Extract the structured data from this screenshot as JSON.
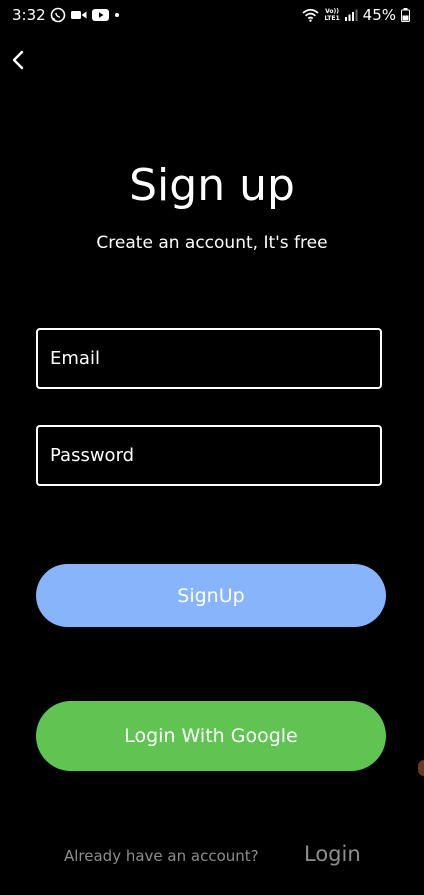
{
  "status_bar": {
    "time": "3:32",
    "lte_top": "Vo))",
    "lte_bottom": "LTE1",
    "battery": "45%"
  },
  "header": {
    "back_icon": "chevron-left-icon"
  },
  "main": {
    "title": "Sign up",
    "subtitle": "Create an account, It's free",
    "email_placeholder": "Email",
    "password_placeholder": "Password",
    "signup_label": "SignUp",
    "google_label": "Login With Google"
  },
  "footer": {
    "prompt": "Already have an account?",
    "login_label": "Login"
  },
  "colors": {
    "background": "#000000",
    "signup_button": "#88b4fb",
    "google_button": "#5fc452",
    "footer_text": "#8d8d8d"
  }
}
